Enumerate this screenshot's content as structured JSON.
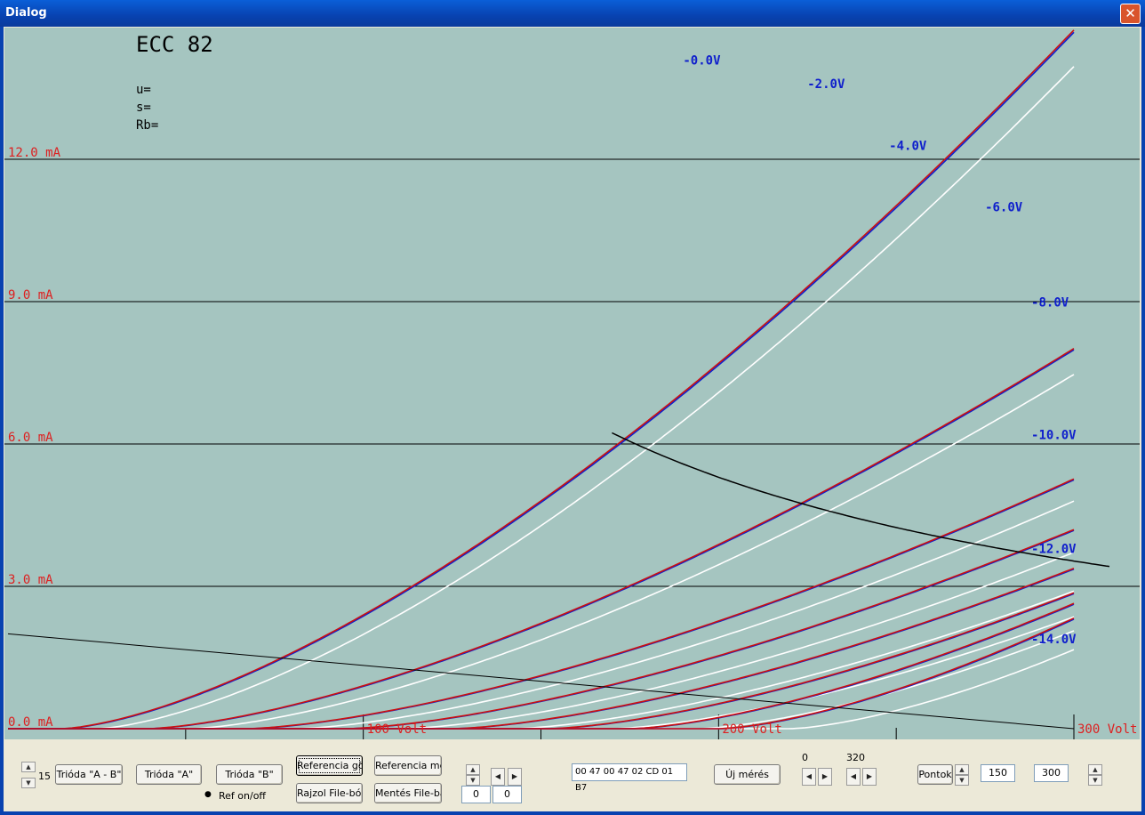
{
  "window": {
    "title": "Dialog",
    "close_glyph": "✕"
  },
  "chart_data": {
    "type": "line",
    "title": "ECC 82",
    "info_labels": [
      "u=",
      "s=",
      "Rb="
    ],
    "xlabel": "Volt",
    "ylabel": "mA",
    "xlim": [
      0,
      300
    ],
    "ylim": [
      0,
      15
    ],
    "x_tick_labels": [
      "100 Volt",
      "200 Volt",
      "300 Volt"
    ],
    "x_ticks": [
      100,
      200,
      300
    ],
    "x_minor_ticks": [
      50,
      150,
      250
    ],
    "y_tick_labels": [
      "0.0 mA",
      "3.0 mA",
      "6.0 mA",
      "9.0 mA",
      "12.0 mA"
    ],
    "y_ticks": [
      0,
      3,
      6,
      9,
      12
    ],
    "grid": true,
    "background": "#a5c5c0",
    "colors": {
      "measured_red": "#cc1010",
      "measured_blue": "#1020cc",
      "reference": "#ffffff",
      "axis_label": "#dd2020",
      "curve_label": "#1020cc"
    },
    "series": [
      {
        "name": "-0.0V",
        "v0": 15,
        "k": 0.00306,
        "label_at": [
          190,
          14
        ]
      },
      {
        "name": "-2.0V",
        "v0": 39,
        "k": 0.0019,
        "label_at": [
          225,
          13.5
        ]
      },
      {
        "name": "-4.0V",
        "v0": 67,
        "k": 0.00148,
        "label_at": [
          248,
          12.2
        ]
      },
      {
        "name": "-6.0V",
        "v0": 95,
        "k": 0.00143,
        "label_at": [
          275,
          10.9
        ]
      },
      {
        "name": "-8.0V",
        "v0": 125,
        "k": 0.00146,
        "label_at": [
          288,
          8.9
        ]
      },
      {
        "name": "-10.0V",
        "v0": 152,
        "k": 0.00159,
        "label_at": [
          288,
          6.1
        ]
      },
      {
        "name": "-12.0V",
        "v0": 175,
        "k": 0.00189,
        "label_at": [
          288,
          3.7
        ]
      },
      {
        "name": "-14.0V",
        "v0": 200,
        "k": 0.00233,
        "label_at": [
          288,
          1.8
        ]
      }
    ],
    "reference_offsets": [
      10,
      12,
      14,
      16,
      17,
      18,
      19,
      20
    ],
    "load_hyperbola_p": 1.06,
    "load_line": [
      [
        0,
        2
      ],
      [
        300,
        0
      ]
    ]
  },
  "controls": {
    "spin_value": "15",
    "trioda_ab": "Trióda \"A - B\"",
    "trioda_a": "Trióda  \"A\"",
    "trioda_b": "Trióda  \"B\"",
    "ref_onoff": "Ref on/off",
    "ref_gorbe": "Referencia görbe",
    "ref_mentes": "Referencia mentés",
    "rajzol": "Rajzol File-ból",
    "mentes": "Mentés File-ba",
    "field_a": "0",
    "field_b": "0",
    "hex": "00 47 00 47 02 CD 01 B7",
    "uj_meres": "Új mérés",
    "lbl_0": "0",
    "lbl_320": "320",
    "pontok": "Pontok",
    "val_150": "150",
    "val_300": "300",
    "arrow_up": "▲",
    "arrow_down": "▼",
    "arrow_left": "◀",
    "arrow_right": "▶",
    "radio": "●"
  }
}
